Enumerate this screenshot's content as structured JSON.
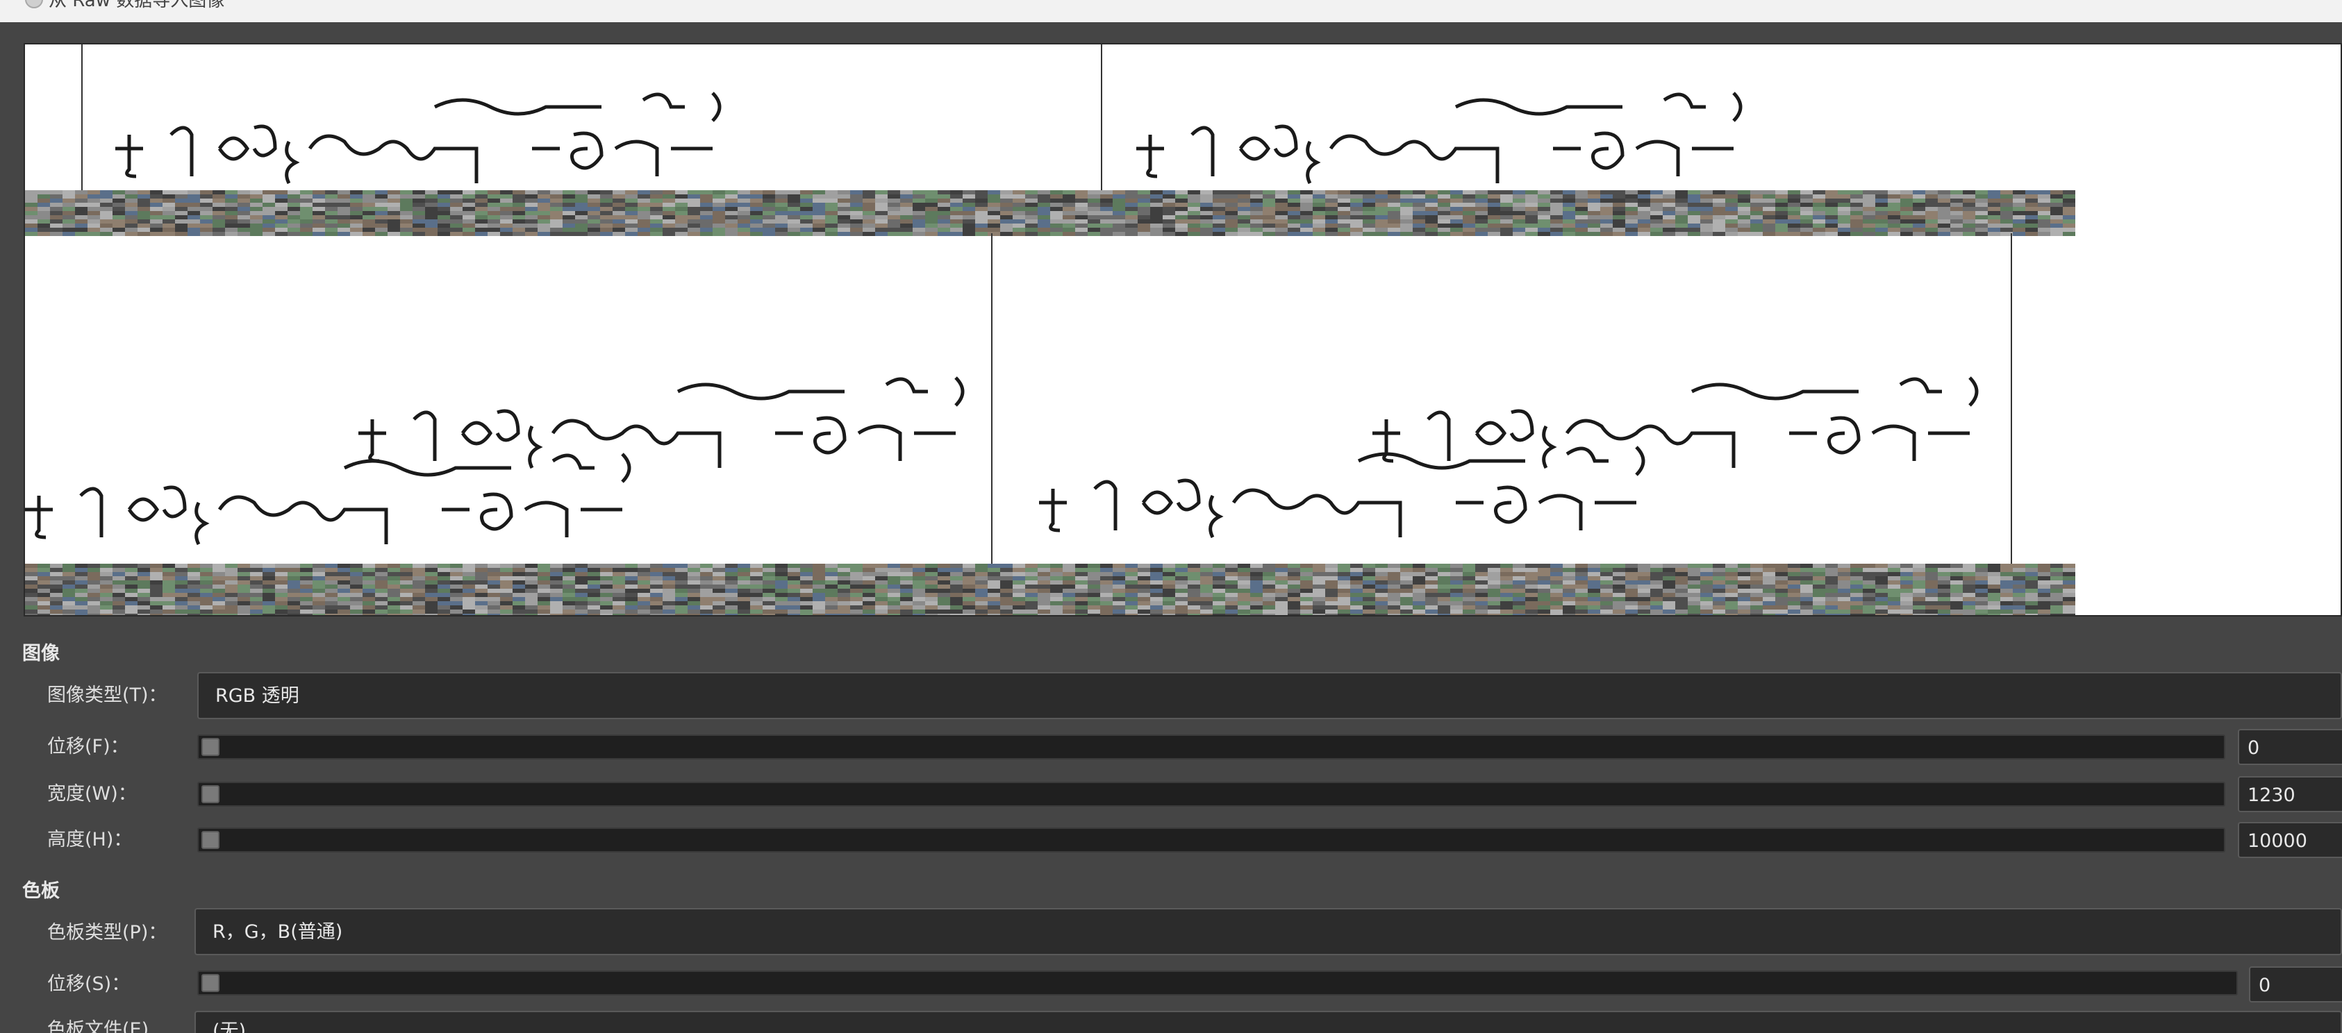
{
  "window": {
    "title": "从 Raw 数据导入图像",
    "icon": "gimp-wilber-icon"
  },
  "image_section": {
    "title": "图像",
    "image_type": {
      "label": "图像类型(T)：",
      "value": "RGB 透明"
    },
    "offset": {
      "label": "位移(F)：",
      "value": "0"
    },
    "width": {
      "label": "宽度(W)：",
      "value": "1230"
    },
    "height": {
      "label": "高度(H)：",
      "value": "10000"
    }
  },
  "palette_section": {
    "title": "色板",
    "palette_type": {
      "label": "色板类型(P)：",
      "value": "R，G，B(普通)"
    },
    "offset": {
      "label": "位移(S)：",
      "value": "0"
    },
    "palette_file": {
      "label": "色板文件(E)",
      "value": "(无)"
    }
  },
  "colors": {
    "dialog_bg": "#454545",
    "field_bg": "#2c2c2c",
    "preview_bg": "#ffffff"
  }
}
